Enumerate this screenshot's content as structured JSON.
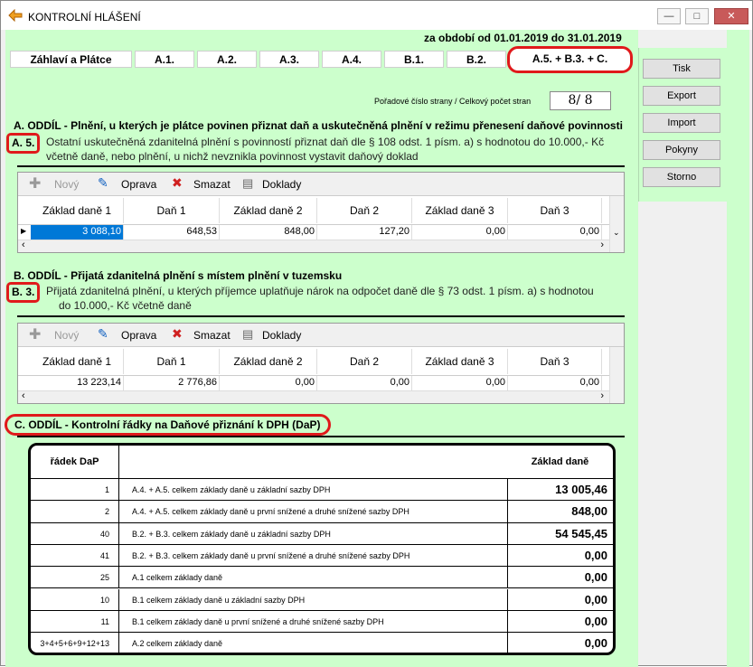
{
  "window": {
    "title": "KONTROLNÍ HLÁŠENÍ",
    "minimize": "—",
    "maximize": "□",
    "close": "✕"
  },
  "period": "za období od 01.01.2019 do 31.01.2019",
  "tabs": [
    "Záhlaví a Plátce",
    "A.1.",
    "A.2.",
    "A.3.",
    "A.4.",
    "B.1.",
    "B.2.",
    "A.5. + B.3. + C."
  ],
  "side_buttons": [
    "Tisk",
    "Export",
    "Import",
    "Pokyny",
    "Storno"
  ],
  "page": {
    "label": "Pořadové číslo strany / Celkový počet stran",
    "value": "8/ 8"
  },
  "sectionA": {
    "heading": "A. ODDÍL - Plnění, u kterých je plátce povinen přiznat daň a uskutečněná plnění v režimu přenesení daňové povinnosti",
    "tag": "A. 5.",
    "line1": "Ostatní uskutečněná zdanitelná plnění s povinností přiznat daň dle § 108 odst. 1 písm. a) s hodnotou do 10.000,- Kč",
    "line2": "včetně daně, nebo plnění, u nichž nevznikla povinnost vystavit daňový doklad"
  },
  "sectionB": {
    "heading": "B. ODDÍL - Přijatá zdanitelná plnění s místem plnění v tuzemsku",
    "tag": "B. 3.",
    "line1": "Přijatá zdanitelná plnění, u kterých příjemce uplatňuje nárok na odpočet daně dle § 73 odst. 1 písm. a) s hodnotou",
    "line2": "do 10.000,- Kč včetně daně"
  },
  "toolbar": {
    "new": "Nový",
    "edit": "Oprava",
    "delete": "Smazat",
    "docs": "Doklady"
  },
  "grid_headers": [
    "Základ daně 1",
    "Daň 1",
    "Základ daně 2",
    "Daň 2",
    "Základ daně 3",
    "Daň 3"
  ],
  "gridA_row": [
    "3 088,10",
    "648,53",
    "848,00",
    "127,20",
    "0,00",
    "0,00"
  ],
  "gridB_row": [
    "13 223,14",
    "2 776,86",
    "0,00",
    "0,00",
    "0,00",
    "0,00"
  ],
  "sectionC": {
    "heading": "C. ODDÍL - Kontrolní řádky na Daňové přiznání k DPH (DaP)",
    "col1": "řádek DaP",
    "col3": "Základ daně",
    "rows": [
      {
        "line": "1",
        "desc": "A.4. + A.5. celkem základy daně u základní sazby DPH",
        "value": "13 005,46"
      },
      {
        "line": "2",
        "desc": "A.4. + A.5. celkem základy daně u první snížené a druhé snížené sazby DPH",
        "value": "848,00"
      },
      {
        "line": "40",
        "desc": "B.2. + B.3. celkem základy daně u základní sazby DPH",
        "value": "54 545,45"
      },
      {
        "line": "41",
        "desc": "B.2. + B.3. celkem základy daně u první snížené a druhé snížené sazby DPH",
        "value": "0,00"
      },
      {
        "line": "25",
        "desc": "A.1 celkem základy daně",
        "value": "0,00"
      },
      {
        "line": "10",
        "desc": "B.1 celkem základy daně u základní sazby DPH",
        "value": "0,00"
      },
      {
        "line": "11",
        "desc": "B.1 celkem základy daně u první snížené a druhé snížené sazby DPH",
        "value": "0,00"
      },
      {
        "line": "3+4+5+6+9+12+13",
        "desc": "A.2 celkem základy daně",
        "value": "0,00"
      }
    ]
  },
  "colors": {
    "panel": "#ccffcc",
    "highlight": "#e0191b",
    "selected": "#0078d7"
  }
}
